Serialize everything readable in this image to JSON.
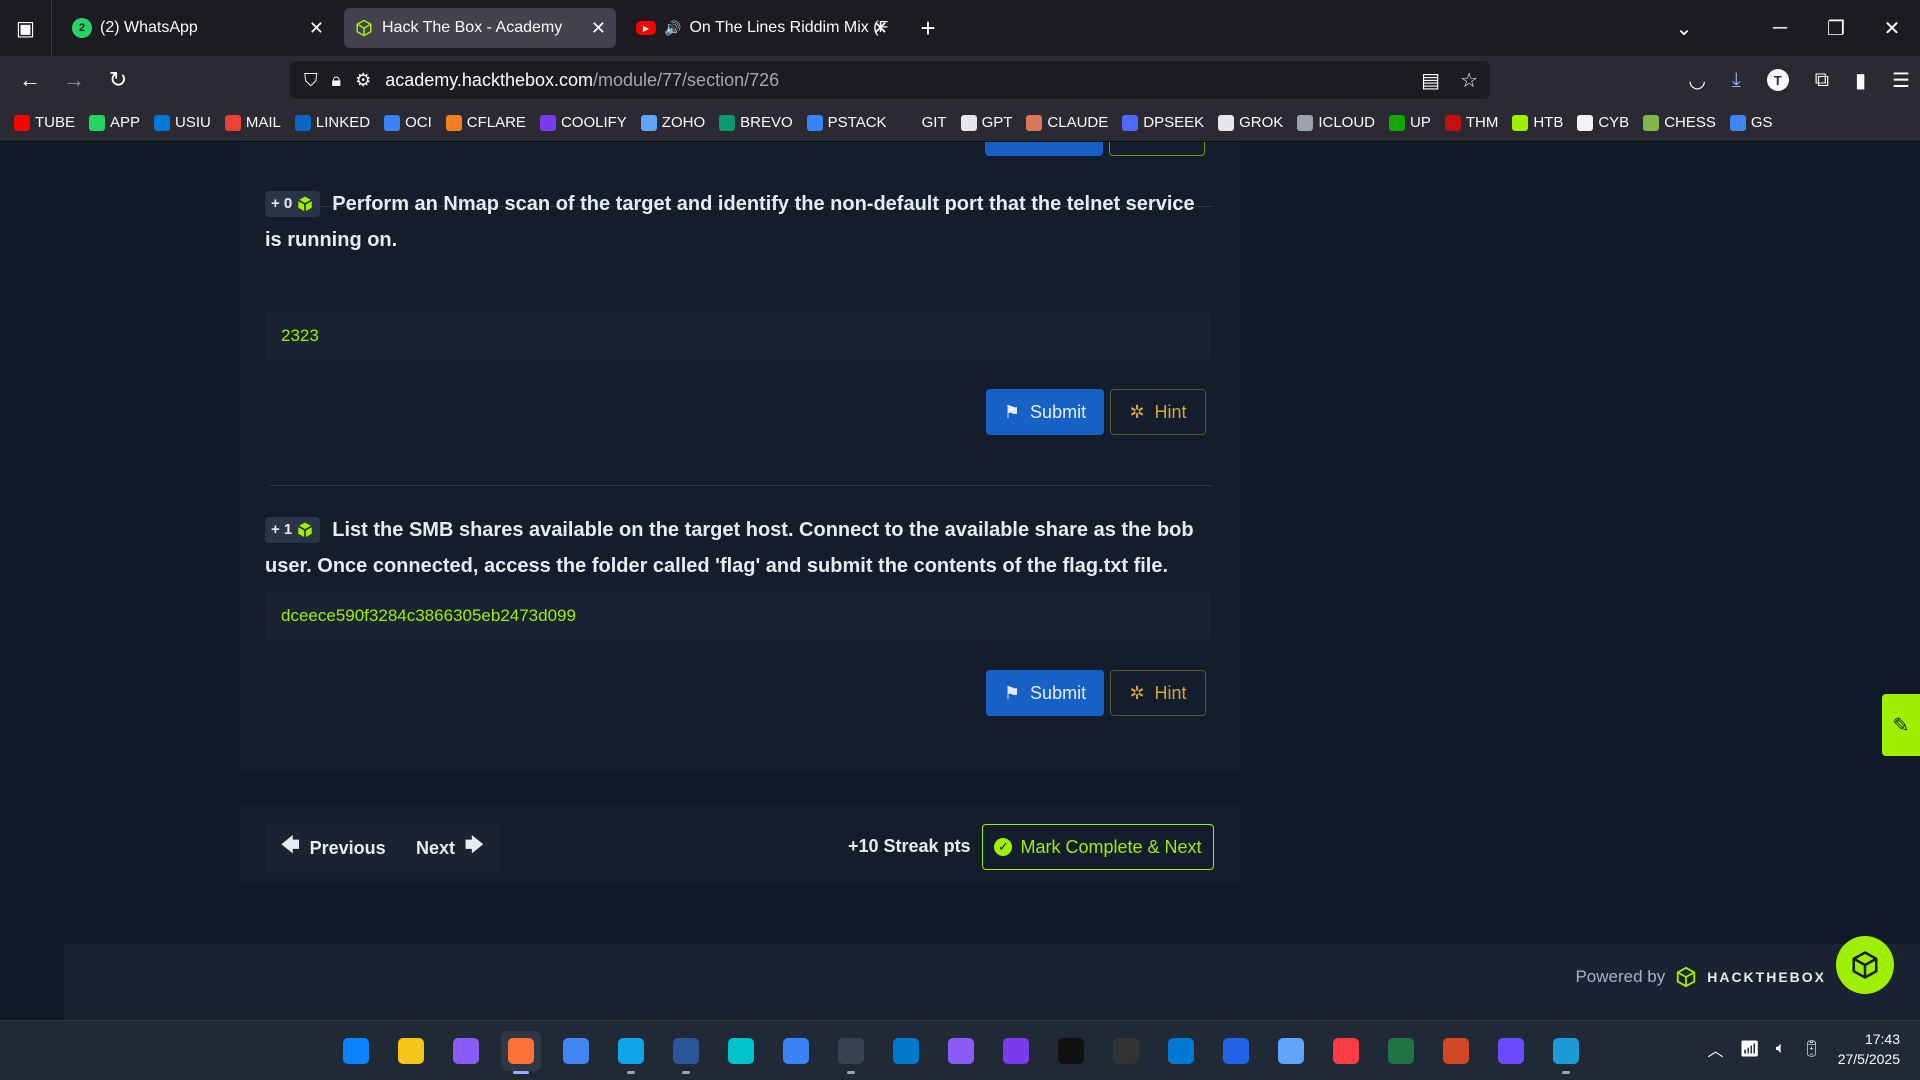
{
  "browser": {
    "tabs": [
      {
        "title": "(2) WhatsApp",
        "badge": "2",
        "color": "#25d366",
        "active": false
      },
      {
        "title": "Hack The Box - Academy",
        "badge": "",
        "color": "#9fef00",
        "active": true
      },
      {
        "title": "On The Lines Riddim Mix (F",
        "badge": "",
        "color": "#ff0000",
        "active": false
      }
    ],
    "url_host": "academy.hackthebox.com",
    "url_path": "/module/77/section/726",
    "bookmarks": [
      {
        "label": "TUBE",
        "color": "#ff0000"
      },
      {
        "label": "APP",
        "color": "#25d366"
      },
      {
        "label": "USIU",
        "color": "#0078d4"
      },
      {
        "label": "MAIL",
        "color": "#ea4335"
      },
      {
        "label": "LINKED",
        "color": "#0a66c2"
      },
      {
        "label": "OCI",
        "color": "#3b82f6"
      },
      {
        "label": "CFLARE",
        "color": "#f38020"
      },
      {
        "label": "COOLIFY",
        "color": "#7c3aed"
      },
      {
        "label": "ZOHO",
        "color": "#60a5fa"
      },
      {
        "label": "BREVO",
        "color": "#0b996e"
      },
      {
        "label": "PSTACK",
        "color": "#3b82f6"
      },
      {
        "label": "GIT",
        "color": "#2b2a33"
      },
      {
        "label": "GPT",
        "color": "#e5e7eb"
      },
      {
        "label": "CLAUDE",
        "color": "#d97757"
      },
      {
        "label": "DPSEEK",
        "color": "#4d6bfe"
      },
      {
        "label": "GROK",
        "color": "#e5e7eb"
      },
      {
        "label": "ICLOUD",
        "color": "#9ca3af"
      },
      {
        "label": "UP",
        "color": "#14a800"
      },
      {
        "label": "THM",
        "color": "#c11111"
      },
      {
        "label": "HTB",
        "color": "#9fef00"
      },
      {
        "label": "CYB",
        "color": "#f3f4f6"
      },
      {
        "label": "CHESS",
        "color": "#81b64c"
      },
      {
        "label": "GS",
        "color": "#4285f4"
      }
    ]
  },
  "questions": [
    {
      "points": "+ 0",
      "text": "Perform an Nmap scan of the target and identify the non-default port that the telnet service is running on.",
      "answer": "2323",
      "submit_label": "Submit",
      "hint_label": "Hint"
    },
    {
      "points": "+ 1",
      "text": "List the SMB shares available on the target host. Connect to the available share as the bob user. Once connected, access the folder called 'flag' and submit the contents of the flag.txt file.",
      "answer": "dceece590f3284c3866305eb2473d099",
      "submit_label": "Submit",
      "hint_label": "Hint"
    }
  ],
  "pagination": {
    "previous_label": "Previous",
    "next_label": "Next",
    "streak_label": "+10 Streak pts",
    "complete_label": "Mark Complete & Next"
  },
  "footer": {
    "powered_by": "Powered by",
    "brand": "HACKTHEBOX"
  },
  "taskbar": {
    "apps": [
      "start",
      "file-explorer",
      "mask-app",
      "firefox",
      "chrome",
      "edge",
      "word",
      "canva",
      "notepad",
      "terminal",
      "vscode",
      "floppy-app",
      "obsidian",
      "capcut",
      "obs",
      "store",
      "todo",
      "mail",
      "itunes",
      "excel",
      "powerpoint",
      "proton-vpn",
      "vmware"
    ],
    "time": "17:43",
    "date": "27/5/2025"
  },
  "colors": {
    "accent": "#9fef00",
    "submit": "#1760c6",
    "hint": "#d8a23a"
  }
}
